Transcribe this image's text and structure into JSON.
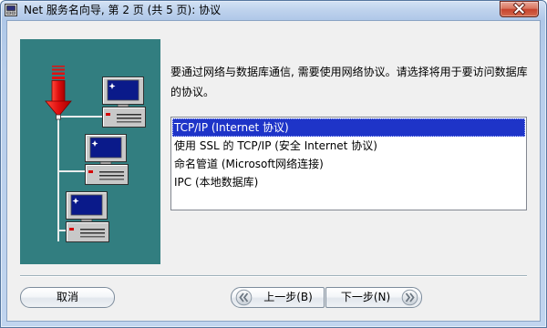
{
  "window": {
    "title": "Net 服务名向导, 第 2 页 (共 5 页): 协议",
    "app_icon": "net-config-app-icon",
    "close_icon": "close-icon"
  },
  "illustration": {
    "arrow_icon": "red-down-arrow-icon",
    "computer_icon": "computer-icon"
  },
  "description": "要通过网络与数据库通信, 需要使用网络协议。请选择将用于要访问数据库的协议。",
  "protocols": {
    "items": [
      "TCP/IP (Internet 协议)",
      "使用 SSL 的 TCP/IP (安全 Internet 协议)",
      "命名管道 (Microsoft网络连接)",
      "IPC (本地数据库)"
    ],
    "selected_index": 0
  },
  "buttons": {
    "cancel": "取消",
    "back": "上一步(B)",
    "back_icon": "chevron-double-left-icon",
    "next": "下一步(N)",
    "next_icon": "chevron-double-right-icon"
  },
  "colors": {
    "illustration_bg": "#327e80",
    "selection_bg": "#1e34c8",
    "selection_text": "#ffffff",
    "dialog_bg": "#f0f0f0",
    "close_button": "#c7432d"
  }
}
